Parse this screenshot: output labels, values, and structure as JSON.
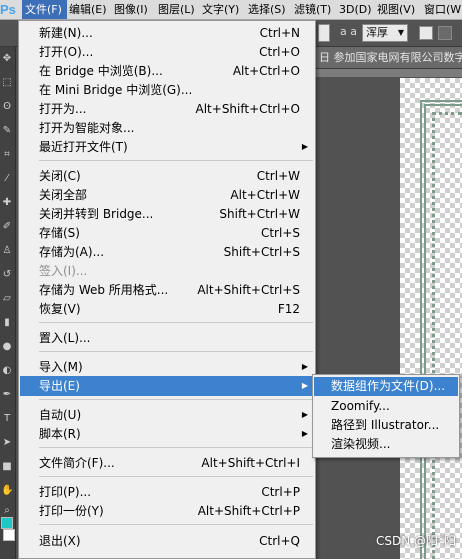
{
  "app": {
    "logo": "Ps"
  },
  "menubar": {
    "items": [
      {
        "label": "文件(F)",
        "active": true
      },
      {
        "label": "编辑(E)"
      },
      {
        "label": "图像(I)"
      },
      {
        "label": "图层(L)"
      },
      {
        "label": "文字(Y)"
      },
      {
        "label": "选择(S)"
      },
      {
        "label": "滤镜(T)"
      },
      {
        "label": "3D(D)"
      },
      {
        "label": "视图(V)"
      },
      {
        "label": "窗口(W)"
      }
    ]
  },
  "options_bar": {
    "antialias_value": "浑厚",
    "aa_label": "a a"
  },
  "document": {
    "tab_title": "日 参加国家电网有限公司数字化"
  },
  "file_menu": {
    "items": [
      {
        "label": "新建(N)...",
        "shortcut": "Ctrl+N"
      },
      {
        "label": "打开(O)...",
        "shortcut": "Ctrl+O"
      },
      {
        "label": "在 Bridge 中浏览(B)...",
        "shortcut": "Alt+Ctrl+O"
      },
      {
        "label": "在 Mini Bridge 中浏览(G)...",
        "shortcut": ""
      },
      {
        "label": "打开为...",
        "shortcut": "Alt+Shift+Ctrl+O"
      },
      {
        "label": "打开为智能对象...",
        "shortcut": ""
      },
      {
        "label": "最近打开文件(T)",
        "shortcut": "",
        "submenu": true
      },
      {
        "label": "关闭(C)",
        "shortcut": "Ctrl+W"
      },
      {
        "label": "关闭全部",
        "shortcut": "Alt+Ctrl+W"
      },
      {
        "label": "关闭并转到 Bridge...",
        "shortcut": "Shift+Ctrl+W"
      },
      {
        "label": "存储(S)",
        "shortcut": "Ctrl+S"
      },
      {
        "label": "存储为(A)...",
        "shortcut": "Shift+Ctrl+S"
      },
      {
        "label": "签入(I)...",
        "shortcut": "",
        "disabled": true
      },
      {
        "label": "存储为 Web 所用格式...",
        "shortcut": "Alt+Shift+Ctrl+S"
      },
      {
        "label": "恢复(V)",
        "shortcut": "F12"
      },
      {
        "label": "置入(L)...",
        "shortcut": ""
      },
      {
        "label": "导入(M)",
        "shortcut": "",
        "submenu": true
      },
      {
        "label": "导出(E)",
        "shortcut": "",
        "submenu": true,
        "highlighted": true
      },
      {
        "label": "自动(U)",
        "shortcut": "",
        "submenu": true
      },
      {
        "label": "脚本(R)",
        "shortcut": "",
        "submenu": true
      },
      {
        "label": "文件简介(F)...",
        "shortcut": "Alt+Shift+Ctrl+I"
      },
      {
        "label": "打印(P)...",
        "shortcut": "Ctrl+P"
      },
      {
        "label": "打印一份(Y)",
        "shortcut": "Alt+Shift+Ctrl+P"
      },
      {
        "label": "退出(X)",
        "shortcut": "Ctrl+Q"
      }
    ]
  },
  "export_submenu": {
    "items": [
      {
        "label": "数据组作为文件(D)...",
        "highlighted": true
      },
      {
        "label": "Zoomify..."
      },
      {
        "label": "路径到 Illustrator..."
      },
      {
        "label": "渲染视频..."
      }
    ]
  },
  "watermark": "CSDN @阳*阳",
  "colors": {
    "menu_highlight": "#3d82cf",
    "menubar_active": "#3d6eb8",
    "menu_bg": "#f0f0f0",
    "workspace_bg": "#535353",
    "ornament_green": "#7d9b8a",
    "foreground_swatch": "#1fc6c6"
  }
}
